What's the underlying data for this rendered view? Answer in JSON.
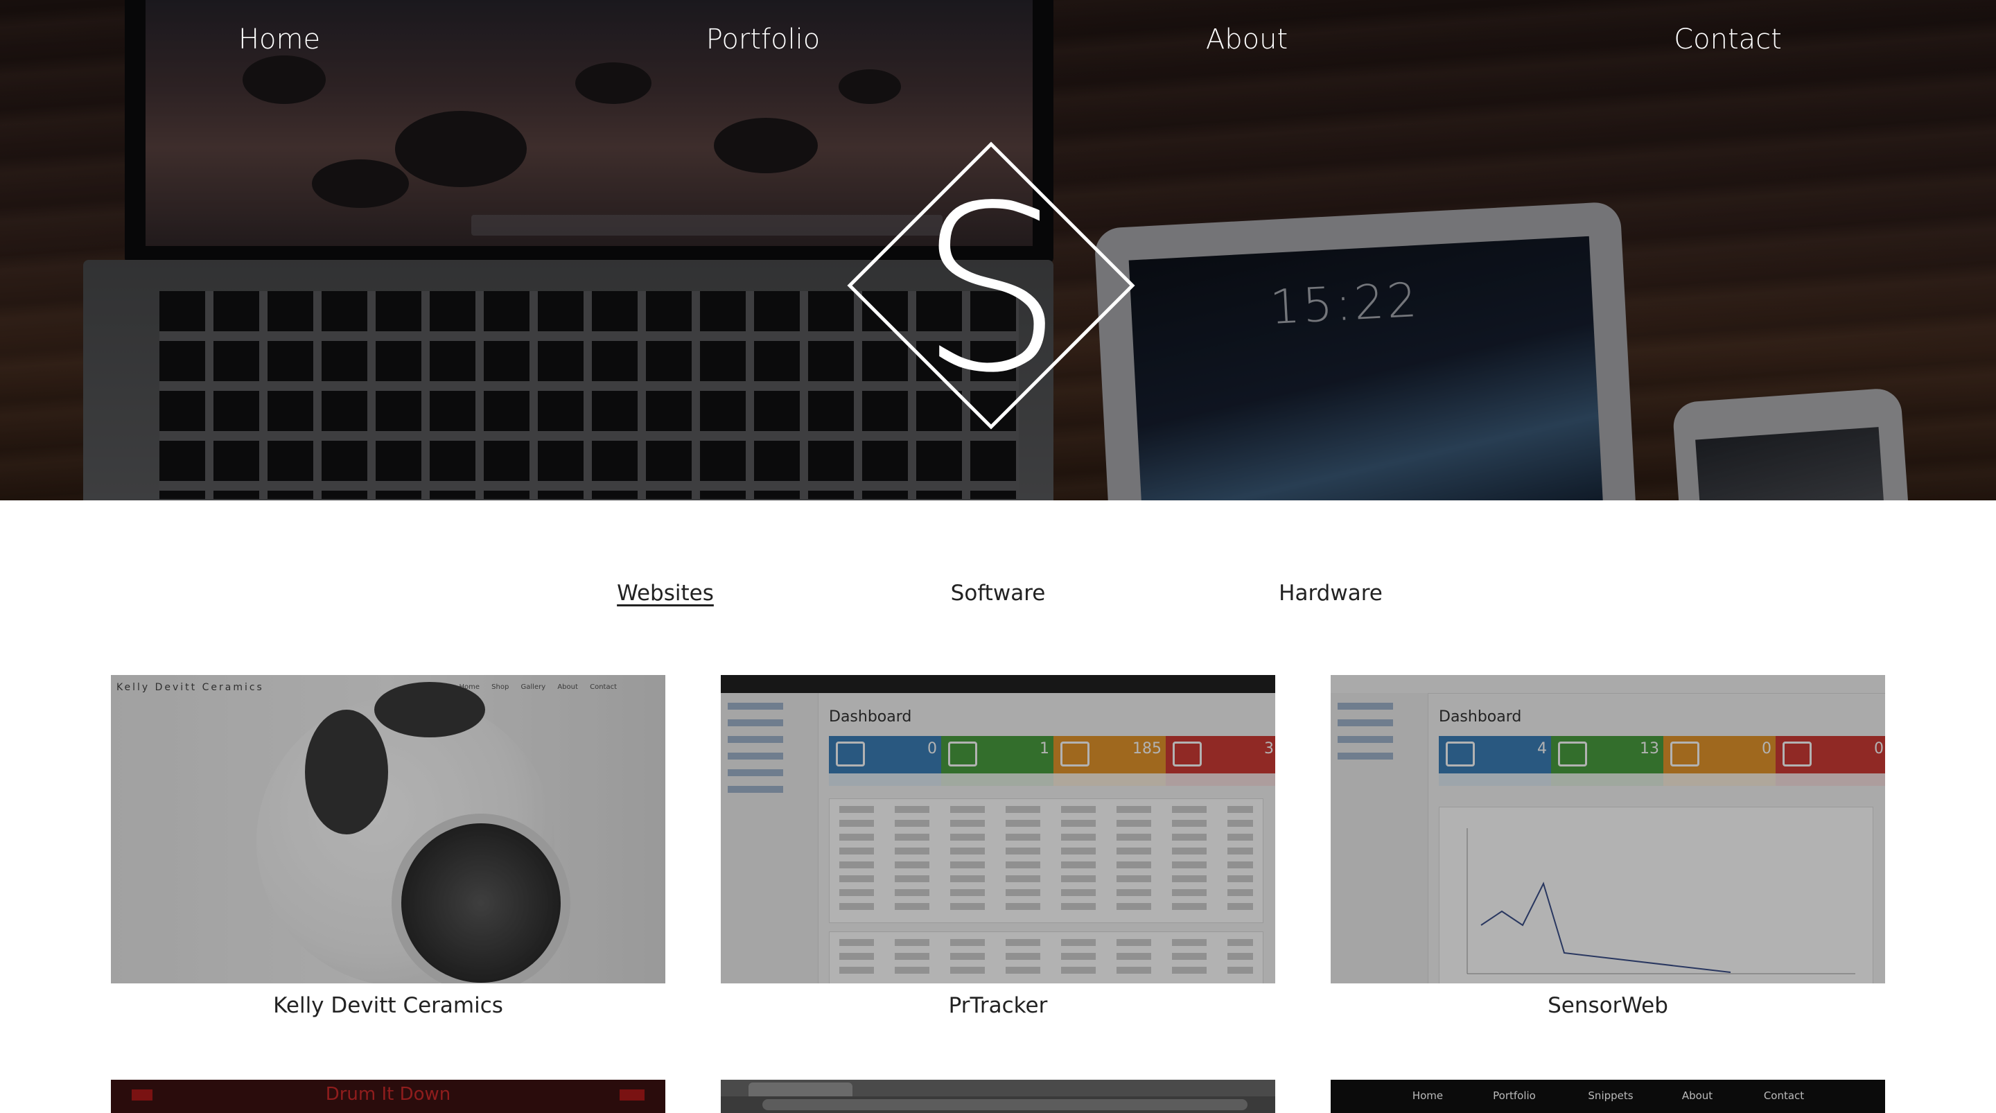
{
  "nav": {
    "items": [
      "Home",
      "Portfolio",
      "About",
      "Contact"
    ]
  },
  "logo": {
    "letter": "S"
  },
  "tablet": {
    "time": "15:22"
  },
  "filters": {
    "items": [
      "Websites",
      "Software",
      "Hardware"
    ],
    "active": "Websites"
  },
  "projects": [
    {
      "title": "Kelly Devitt Ceramics"
    },
    {
      "title": "PrTracker"
    },
    {
      "title": "SensorWeb"
    }
  ],
  "thumbs": {
    "kelly": {
      "brand": "Kelly Devitt Ceramics",
      "nav": [
        "Home",
        "Shop",
        "Gallery",
        "About",
        "Contact"
      ]
    },
    "prtracker": {
      "heading": "Dashboard",
      "tiles": [
        "0",
        "1",
        "185",
        "3"
      ]
    },
    "sensorweb": {
      "heading": "Dashboard",
      "tiles": [
        "4",
        "13",
        "0",
        "0"
      ]
    },
    "drum": {
      "title": "Drum It Down"
    },
    "dark": {
      "nav": [
        "Home",
        "Portfolio",
        "Snippets",
        "About",
        "Contact"
      ]
    }
  },
  "colors": {
    "tile_blue": "#3b7fb8",
    "tile_green": "#4a9e3f",
    "tile_orange": "#e4962c",
    "tile_red": "#cf3b35"
  }
}
